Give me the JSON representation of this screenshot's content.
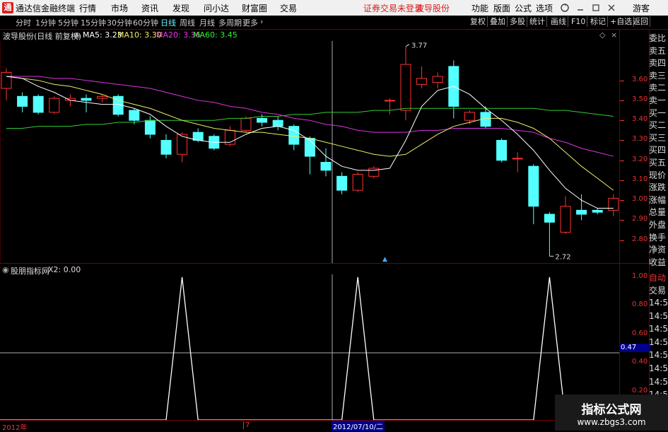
{
  "titlebar": {
    "app_name": "通达信金融终端",
    "menus": [
      "行情",
      "市场",
      "资讯",
      "发现",
      "问小达",
      "财富圈",
      "交易"
    ],
    "status": "证券交易未登录",
    "stock": "波导股份",
    "right_menus": [
      "功能",
      "版面",
      "公式",
      "选项"
    ],
    "guest": "游客"
  },
  "toolbar": {
    "periods": [
      "分时",
      "1分钟",
      "5分钟",
      "15分钟",
      "30分钟",
      "60分钟",
      "日线",
      "周线",
      "月线",
      "多周期",
      "更多"
    ],
    "active": "日线",
    "buttons": [
      "复权",
      "叠加",
      "多股",
      "统计",
      "画线",
      "F10",
      "标记",
      "+自选",
      "返回"
    ]
  },
  "info": {
    "name": "波导股份(日线 前复权)",
    "ma5": "MA5: 3.23",
    "ma10": "MA10: 3.30",
    "ma20": "MA20: 3.36",
    "ma60": "MA60: 3.45",
    "high_label": "3.77",
    "low_label": "2.72"
  },
  "indicator": {
    "name": "股朋指标网",
    "value": "X2: 0.00",
    "cursor_value": "0.47"
  },
  "axis": {
    "main_ticks": [
      "3.60",
      "3.50",
      "3.40",
      "3.30",
      "3.20",
      "3.10",
      "3.00",
      "2.90",
      "2.80"
    ],
    "ind_ticks": [
      "1.00",
      "0.80",
      "0.60",
      "0.40",
      "0.20"
    ],
    "date_start": "2012年",
    "date_mid": "7",
    "date_cursor": "2012/07/10/二"
  },
  "sidebar": {
    "items": [
      "委比",
      "卖五",
      "卖四",
      "卖三",
      "卖二",
      "卖一",
      "买一",
      "买二",
      "买三",
      "买四",
      "买五",
      "现价",
      "涨跌",
      "涨幅",
      "总量",
      "外盘",
      "换手",
      "净资",
      "收益"
    ],
    "ind_items": [
      "自动",
      "交易"
    ],
    "times": [
      "14:56",
      "14:56",
      "14:56",
      "14:56",
      "14:56",
      "14:56",
      "14:56",
      "14:56"
    ]
  },
  "watermark": {
    "title": "指标公式网",
    "url": "www.zbgs3.com"
  },
  "chart_data": {
    "type": "candlestick",
    "ylim": [
      2.72,
      3.77
    ],
    "candles": [
      {
        "o": 3.56,
        "c": 3.64,
        "h": 3.66,
        "l": 3.5
      },
      {
        "o": 3.52,
        "c": 3.47,
        "h": 3.54,
        "l": 3.44
      },
      {
        "o": 3.52,
        "c": 3.44,
        "h": 3.53,
        "l": 3.43
      },
      {
        "o": 3.44,
        "c": 3.51,
        "h": 3.52,
        "l": 3.43
      },
      {
        "o": 3.5,
        "c": 3.51,
        "h": 3.53,
        "l": 3.47
      },
      {
        "o": 3.51,
        "c": 3.5,
        "h": 3.53,
        "l": 3.44
      },
      {
        "o": 3.51,
        "c": 3.52,
        "h": 3.53,
        "l": 3.49
      },
      {
        "o": 3.52,
        "c": 3.43,
        "h": 3.53,
        "l": 3.42
      },
      {
        "o": 3.45,
        "c": 3.4,
        "h": 3.46,
        "l": 3.38
      },
      {
        "o": 3.4,
        "c": 3.33,
        "h": 3.42,
        "l": 3.31
      },
      {
        "o": 3.3,
        "c": 3.23,
        "h": 3.33,
        "l": 3.21
      },
      {
        "o": 3.23,
        "c": 3.33,
        "h": 3.34,
        "l": 3.19
      },
      {
        "o": 3.34,
        "c": 3.3,
        "h": 3.36,
        "l": 3.29
      },
      {
        "o": 3.32,
        "c": 3.26,
        "h": 3.33,
        "l": 3.25
      },
      {
        "o": 3.28,
        "c": 3.35,
        "h": 3.37,
        "l": 3.27
      },
      {
        "o": 3.35,
        "c": 3.41,
        "h": 3.42,
        "l": 3.34
      },
      {
        "o": 3.41,
        "c": 3.39,
        "h": 3.43,
        "l": 3.37
      },
      {
        "o": 3.4,
        "c": 3.37,
        "h": 3.42,
        "l": 3.35
      },
      {
        "o": 3.37,
        "c": 3.28,
        "h": 3.38,
        "l": 3.25
      },
      {
        "o": 3.31,
        "c": 3.22,
        "h": 3.32,
        "l": 3.13
      },
      {
        "o": 3.19,
        "c": 3.15,
        "h": 3.26,
        "l": 3.12
      },
      {
        "o": 3.12,
        "c": 3.05,
        "h": 3.14,
        "l": 3.03
      },
      {
        "o": 3.05,
        "c": 3.13,
        "h": 3.14,
        "l": 3.04
      },
      {
        "o": 3.12,
        "c": 3.16,
        "h": 3.17,
        "l": 3.11
      },
      {
        "o": 3.5,
        "c": 3.5,
        "h": 3.51,
        "l": 3.43
      },
      {
        "o": 3.45,
        "c": 3.68,
        "h": 3.77,
        "l": 3.4
      },
      {
        "o": 3.58,
        "c": 3.61,
        "h": 3.67,
        "l": 3.56
      },
      {
        "o": 3.59,
        "c": 3.62,
        "h": 3.64,
        "l": 3.56
      },
      {
        "o": 3.67,
        "c": 3.47,
        "h": 3.7,
        "l": 3.41
      },
      {
        "o": 3.4,
        "c": 3.44,
        "h": 3.45,
        "l": 3.38
      },
      {
        "o": 3.44,
        "c": 3.37,
        "h": 3.47,
        "l": 3.36
      },
      {
        "o": 3.3,
        "c": 3.2,
        "h": 3.31,
        "l": 3.19
      },
      {
        "o": 3.21,
        "c": 3.21,
        "h": 3.24,
        "l": 3.14
      },
      {
        "o": 3.17,
        "c": 2.97,
        "h": 3.18,
        "l": 2.88
      },
      {
        "o": 2.93,
        "c": 2.89,
        "h": 2.94,
        "l": 2.72
      },
      {
        "o": 2.84,
        "c": 2.97,
        "h": 3.02,
        "l": 2.83
      },
      {
        "o": 2.95,
        "c": 2.93,
        "h": 3.03,
        "l": 2.9
      },
      {
        "o": 2.95,
        "c": 2.94,
        "h": 2.96,
        "l": 2.93
      },
      {
        "o": 2.95,
        "c": 3.01,
        "h": 3.03,
        "l": 2.92
      }
    ],
    "ma5": [
      3.62,
      3.61,
      3.57,
      3.54,
      3.5,
      3.49,
      3.48,
      3.48,
      3.46,
      3.43,
      3.37,
      3.32,
      3.3,
      3.29,
      3.29,
      3.33,
      3.36,
      3.37,
      3.35,
      3.3,
      3.22,
      3.17,
      3.15,
      3.15,
      3.16,
      3.3,
      3.47,
      3.55,
      3.57,
      3.53,
      3.46,
      3.4,
      3.33,
      3.25,
      3.15,
      3.06,
      3.0,
      2.96,
      2.96
    ],
    "ma10": [
      3.62,
      3.61,
      3.6,
      3.58,
      3.57,
      3.55,
      3.53,
      3.5,
      3.48,
      3.46,
      3.43,
      3.4,
      3.38,
      3.36,
      3.35,
      3.34,
      3.34,
      3.33,
      3.32,
      3.31,
      3.29,
      3.27,
      3.25,
      3.23,
      3.22,
      3.23,
      3.28,
      3.33,
      3.37,
      3.39,
      3.41,
      3.41,
      3.39,
      3.36,
      3.31,
      3.24,
      3.17,
      3.11,
      3.05
    ],
    "ma20": [
      3.62,
      3.62,
      3.62,
      3.61,
      3.61,
      3.6,
      3.59,
      3.58,
      3.57,
      3.56,
      3.54,
      3.52,
      3.5,
      3.49,
      3.47,
      3.46,
      3.44,
      3.43,
      3.41,
      3.4,
      3.38,
      3.37,
      3.35,
      3.34,
      3.34,
      3.34,
      3.35,
      3.35,
      3.36,
      3.36,
      3.36,
      3.36,
      3.35,
      3.34,
      3.31,
      3.29,
      3.26,
      3.24,
      3.22
    ],
    "ma60": [
      3.36,
      3.36,
      3.37,
      3.37,
      3.37,
      3.38,
      3.38,
      3.39,
      3.39,
      3.4,
      3.4,
      3.4,
      3.4,
      3.4,
      3.41,
      3.41,
      3.42,
      3.42,
      3.43,
      3.43,
      3.44,
      3.44,
      3.44,
      3.45,
      3.45,
      3.46,
      3.46,
      3.46,
      3.46,
      3.46,
      3.46,
      3.46,
      3.46,
      3.46,
      3.45,
      3.45,
      3.44,
      3.43,
      3.42
    ],
    "indicator_ylim": [
      0,
      1
    ],
    "indicator_peaks": [
      11,
      22,
      34
    ]
  }
}
